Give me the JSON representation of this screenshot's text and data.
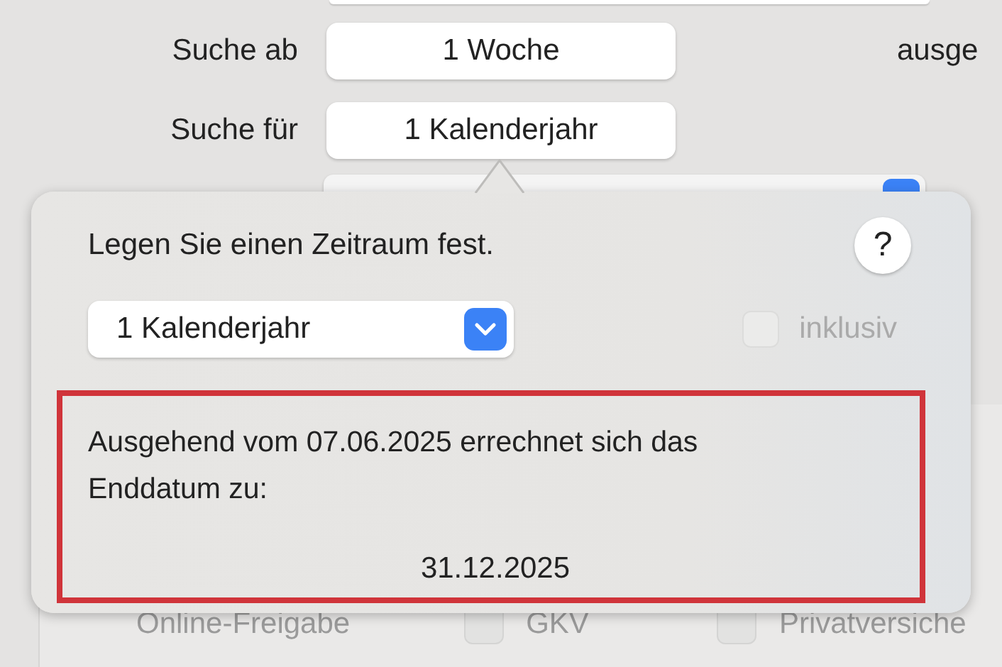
{
  "search_from": {
    "label": "Suche ab",
    "value": "1 Woche"
  },
  "side_text": "ausge",
  "search_for": {
    "label": "Suche für",
    "value": "1 Kalenderjahr"
  },
  "online_release": {
    "label": "Online-Freigabe"
  },
  "checkboxes": [
    {
      "label": "GKV",
      "checked": false
    },
    {
      "label": "Privatversiche",
      "checked": false
    }
  ],
  "popover": {
    "title": "Legen Sie einen Zeitraum fest.",
    "help_button": "?",
    "period_select": {
      "value": "1 Kalenderjahr"
    },
    "inclusive": {
      "label": "inklusiv",
      "checked": false,
      "disabled": true
    },
    "result": {
      "text": "Ausgehend vom 07.06.2025 errechnet sich das Enddatum zu:",
      "date": "31.12.2025"
    }
  }
}
